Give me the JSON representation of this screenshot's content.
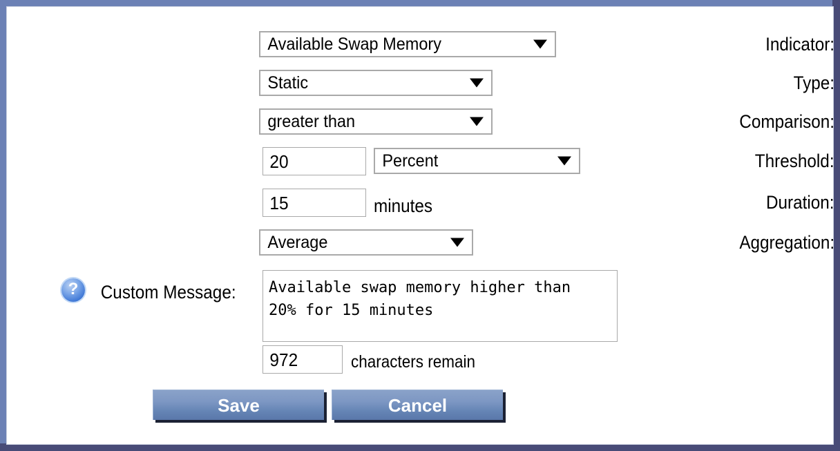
{
  "dialog": {
    "frame_color_top_left": "#6c81b5",
    "frame_color_bottom_right": "#484b77",
    "surface_color": "#ffffff"
  },
  "form": {
    "rows": [
      {
        "label": "Indicator:",
        "value": "Available Swap Memory",
        "control": "select"
      },
      {
        "label": "Type:",
        "value": "Static",
        "control": "select"
      },
      {
        "label": "Comparison:",
        "value": "greater than",
        "control": "select"
      },
      {
        "label": "Threshold:",
        "value": "20",
        "control": "text",
        "unit_select": "Percent"
      },
      {
        "label": "Duration:",
        "value": "15",
        "control": "text",
        "unit_text": "minutes"
      },
      {
        "label": "Aggregation:",
        "value": "Average",
        "control": "select"
      },
      {
        "label": "Custom Message:",
        "value": "Available swap memory higher than\n20% for 15 minutes",
        "control": "textarea"
      }
    ]
  },
  "custom_message": {
    "label": "Custom Message:",
    "text": "Available swap memory higher than\n20% for 15 minutes",
    "help_icon": "question-mark-icon",
    "help_glyph": "?",
    "characters_remain_count": "972",
    "characters_remain_label": "characters remain"
  },
  "buttons": {
    "save_label": "Save",
    "cancel_label": "Cancel",
    "accent_color": "#6c81b5",
    "text_color": "#ffffff"
  },
  "icons": {
    "dropdown_arrow": "chevron-down-icon"
  }
}
